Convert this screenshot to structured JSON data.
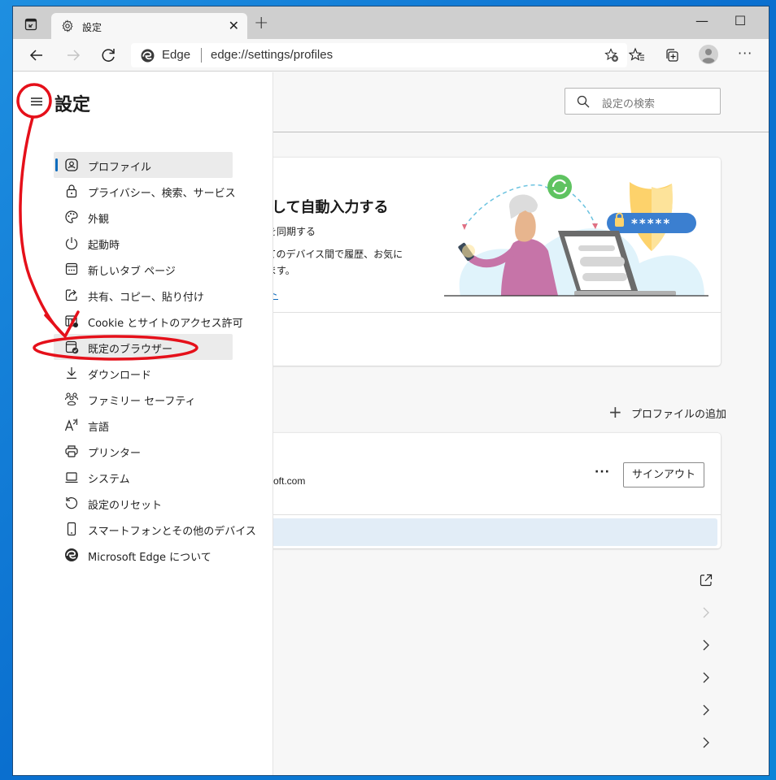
{
  "window": {
    "tab": {
      "title": "設定",
      "icon": "gear-icon"
    },
    "new_tab_label": "+",
    "controls": {
      "minimize": "—",
      "maximize": "☐",
      "close": "✕"
    }
  },
  "toolbar": {
    "site_label": "Edge",
    "url": "edge://settings/profiles",
    "more_label": "···"
  },
  "search": {
    "placeholder": "設定の検索"
  },
  "sidebar": {
    "title": "設定",
    "items": [
      {
        "label": "プロファイル",
        "icon": "profile-icon",
        "active": true
      },
      {
        "label": "プライバシー、検索、サービス",
        "icon": "lock-icon"
      },
      {
        "label": "外観",
        "icon": "palette-icon"
      },
      {
        "label": "起動時",
        "icon": "power-icon"
      },
      {
        "label": "新しいタブ ページ",
        "icon": "new-tab-page-icon"
      },
      {
        "label": "共有、コピー、貼り付け",
        "icon": "share-icon"
      },
      {
        "label": "Cookie とサイトのアクセス許可",
        "icon": "cookie-icon"
      },
      {
        "label": "既定のブラウザー",
        "icon": "default-browser-icon",
        "highlighted": true
      },
      {
        "label": "ダウンロード",
        "icon": "download-icon"
      },
      {
        "label": "ファミリー セーフティ",
        "icon": "family-icon"
      },
      {
        "label": "言語",
        "icon": "language-icon"
      },
      {
        "label": "プリンター",
        "icon": "printer-icon"
      },
      {
        "label": "システム",
        "icon": "system-icon"
      },
      {
        "label": "設定のリセット",
        "icon": "reset-icon"
      },
      {
        "label": "スマートフォンとその他のデバイス",
        "icon": "phone-icon"
      },
      {
        "label": "Microsoft Edge について",
        "icon": "edge-icon"
      }
    ]
  },
  "main": {
    "promo": {
      "heading": "存して自動入力する",
      "subheading": "どを同期する",
      "desc_line1": "べてのデバイス間で履歴、お気に",
      "desc_line2": "れます。",
      "link": "ント",
      "password_mask": "*****"
    },
    "add_profile_label": "プロファイルの追加",
    "account": {
      "email_fragment": "oft.com",
      "more_label": "···",
      "signout_label": "サインアウト"
    }
  },
  "colors": {
    "accent": "#0f6cbd",
    "annotation_red": "#e5101a",
    "banner_bg": "#e2edf7"
  }
}
